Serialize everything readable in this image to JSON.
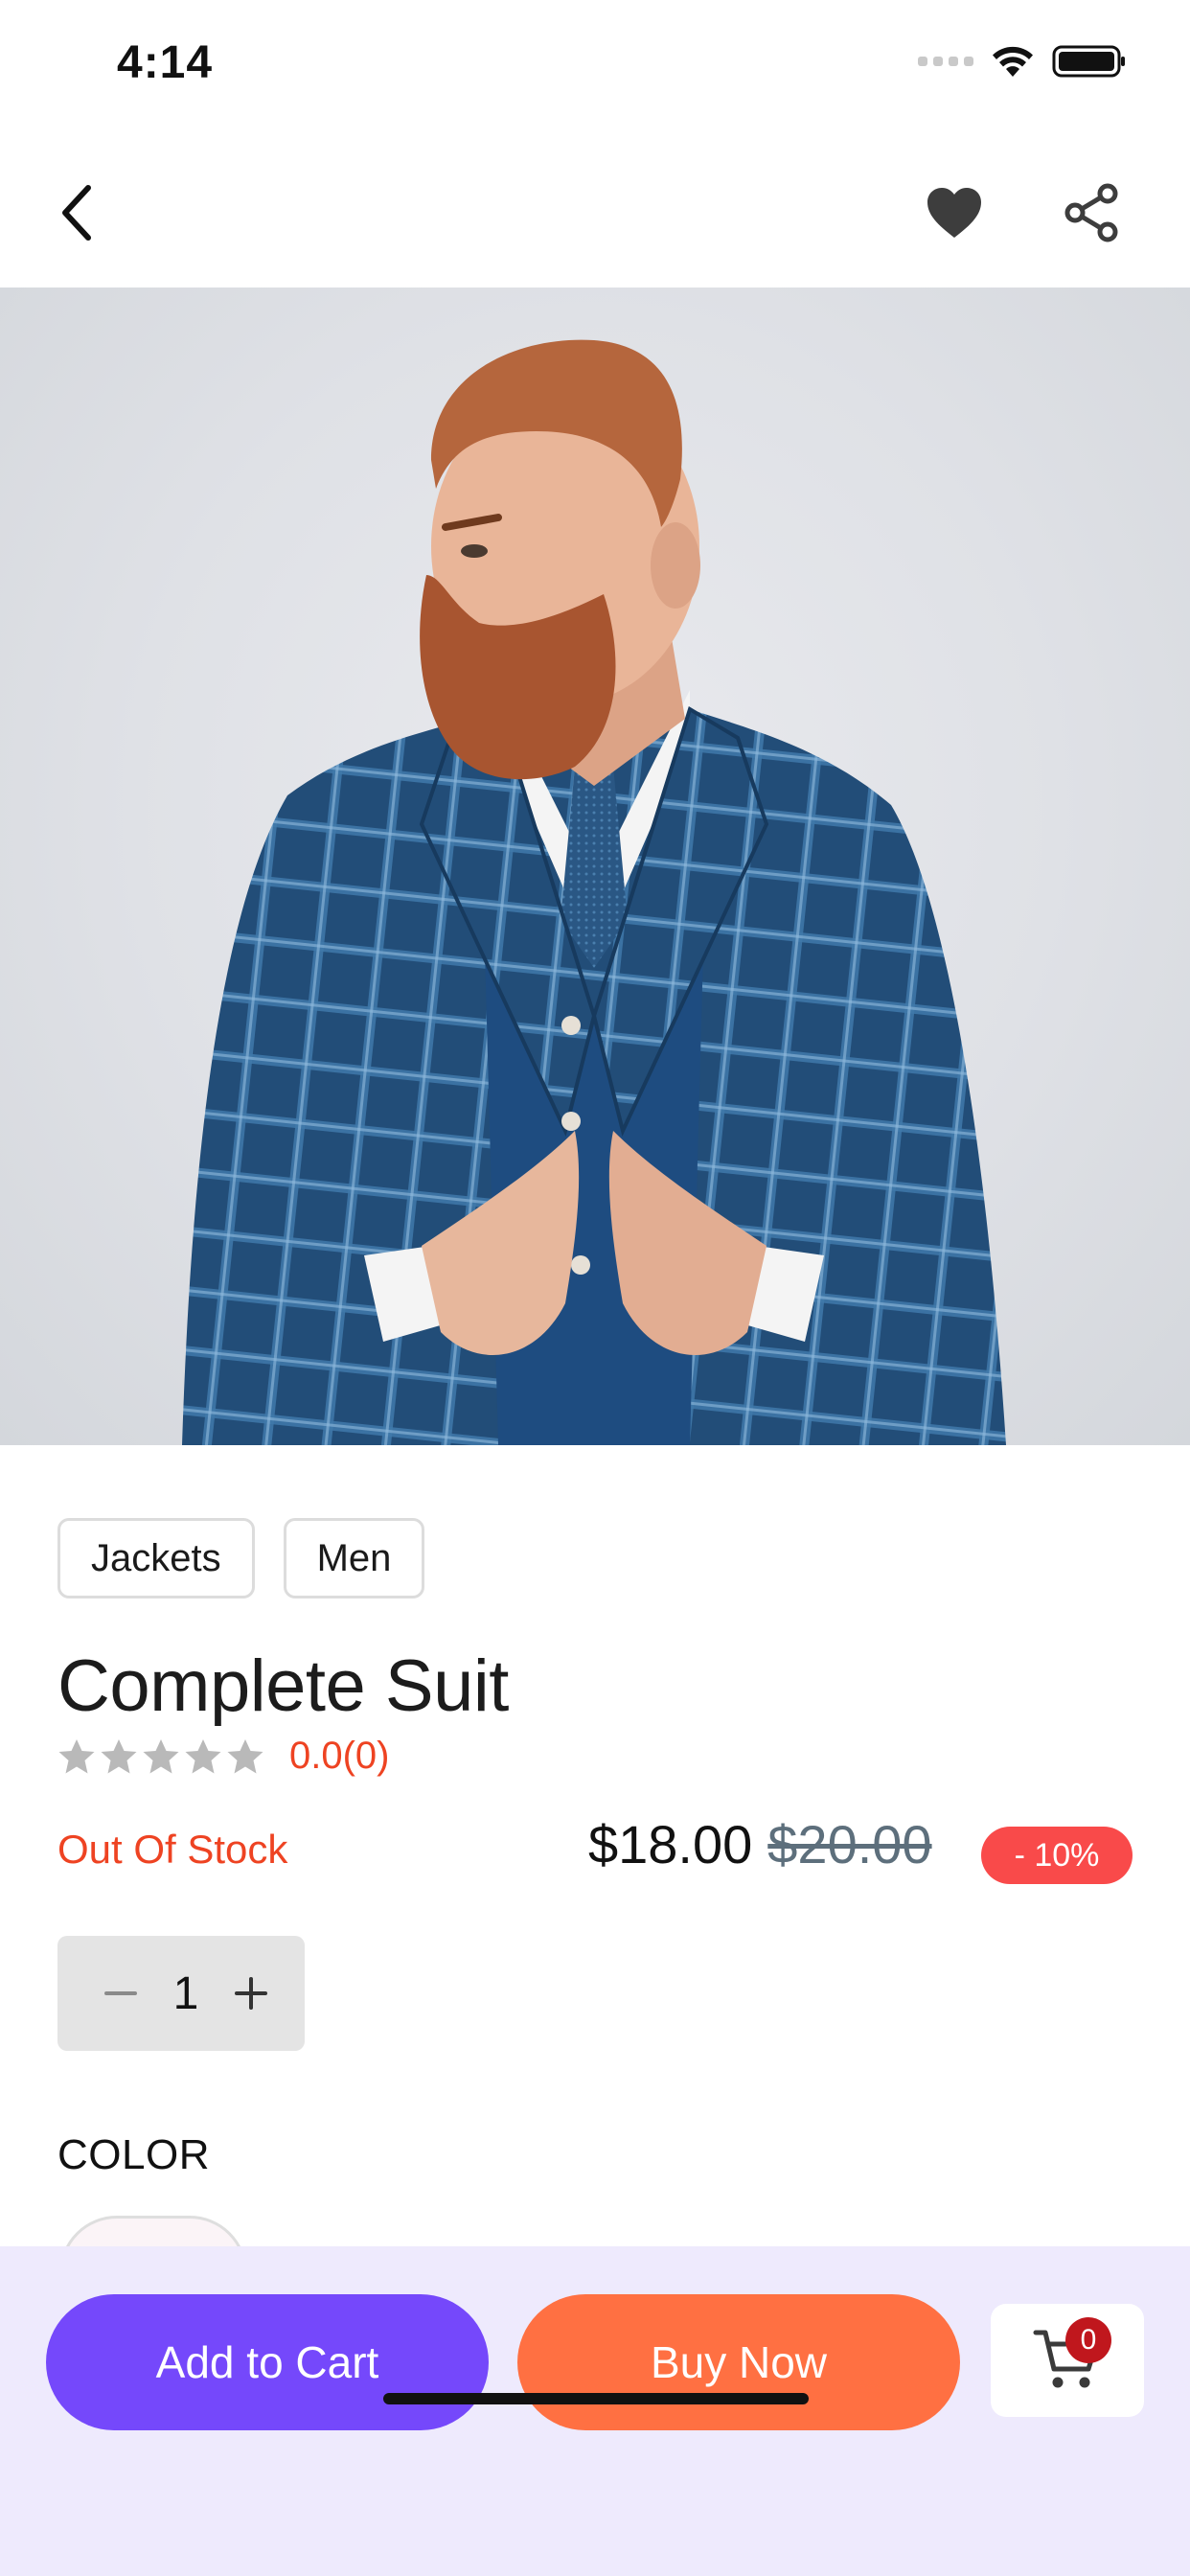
{
  "status_bar": {
    "time": "4:14"
  },
  "nav": {
    "back_icon": "chevron-left-icon",
    "favorite_icon": "heart-icon",
    "share_icon": "share-icon"
  },
  "product": {
    "image_description": "Man with red beard wearing a blue plaid three-piece suit",
    "tags": [
      "Jackets",
      "Men"
    ],
    "title": "Complete Suit",
    "rating": {
      "stars_filled": 0,
      "stars_total": 5,
      "text": "0.0(0)"
    },
    "stock_status": "Out Of Stock",
    "price": "$18.00",
    "old_price": "$20.00",
    "discount": "- 10%",
    "quantity": "1",
    "color_label": "COLOR"
  },
  "actions": {
    "add_to_cart": "Add to Cart",
    "buy_now": "Buy Now",
    "cart_count": "0"
  },
  "colors": {
    "accent_purple": "#7548fb",
    "accent_orange": "#ff7042",
    "alert_red": "#ee4322",
    "discount_red": "#f94a4a",
    "bottom_bar_bg": "#eeeafd"
  }
}
